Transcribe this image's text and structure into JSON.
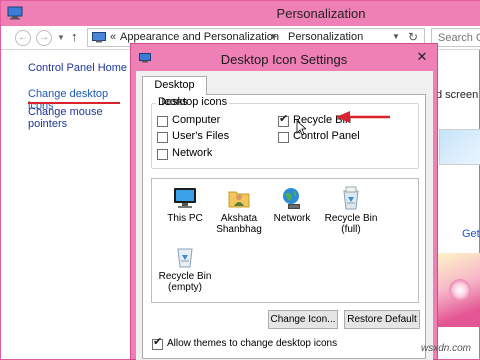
{
  "colors": {
    "titlebar": "#ef80b6",
    "link": "#1e3799",
    "highlight_underline": "#d9232d",
    "arrow": "#d9232d"
  },
  "bg_window": {
    "title": "Personalization",
    "breadcrumb_chevron": "«",
    "breadcrumb": [
      "Appearance and Personalization",
      "Personalization"
    ],
    "breadcrumb_separator": "▸",
    "search_placeholder": "Search Co",
    "left_links": [
      "Control Panel Home",
      "Change desktop icons",
      "Change mouse pointers"
    ],
    "peek_text_1": "d screen sa",
    "peek_text_2": "Get m"
  },
  "dialog": {
    "title": "Desktop Icon Settings",
    "close_glyph": "✕",
    "tab_label": "Desktop Icons",
    "group_label": "Desktop icons",
    "checkboxes": [
      {
        "label": "Computer",
        "checked": false
      },
      {
        "label": "User's Files",
        "checked": false
      },
      {
        "label": "Network",
        "checked": false
      },
      {
        "label": "Recycle Bin",
        "checked": true
      },
      {
        "label": "Control Panel",
        "checked": false
      }
    ],
    "tiles": [
      {
        "label": "This PC",
        "icon": "monitor-icon"
      },
      {
        "label": "Akshata\nShanbhag",
        "icon": "user-folder-icon"
      },
      {
        "label": "Network",
        "icon": "network-globe-icon"
      },
      {
        "label": "Recycle Bin\n(full)",
        "icon": "recycle-bin-full-icon"
      },
      {
        "label": "Recycle Bin\n(empty)",
        "icon": "recycle-bin-empty-icon"
      }
    ],
    "change_icon_button": "Change Icon...",
    "restore_default_button": "Restore Default",
    "allow_themes_label": "Allow themes to change desktop icons",
    "allow_themes_checked": true
  },
  "watermark": "wsxdn.com"
}
